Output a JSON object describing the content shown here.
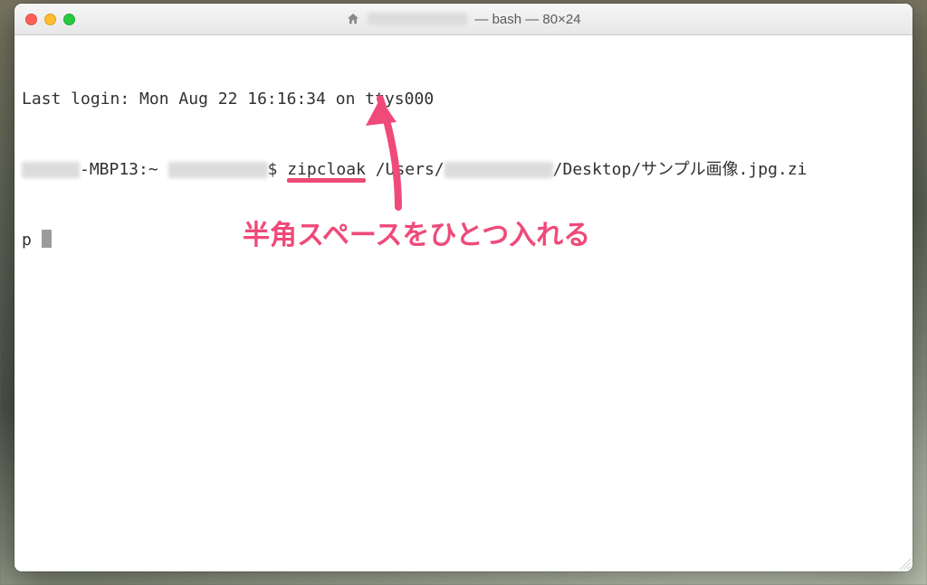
{
  "window": {
    "title_user_masked": "████████",
    "title_suffix": " — bash — 80×24"
  },
  "terminal": {
    "line1_prefix": "Last login: ",
    "last_login": "Mon Aug 22 16:16:34",
    "line1_suffix": " on ttys000",
    "prompt_host_suffix": "-MBP13:~ ",
    "prompt_dollar": "$ ",
    "command": "zipcloak",
    "path_part_a": " /Users/",
    "path_part_b": "/Desktop/サンプル画像.jpg.zi",
    "wrap_tail": "p "
  },
  "annotation": {
    "label": "半角スペースをひとつ入れる"
  },
  "colors": {
    "accent": "#ef4a79"
  }
}
